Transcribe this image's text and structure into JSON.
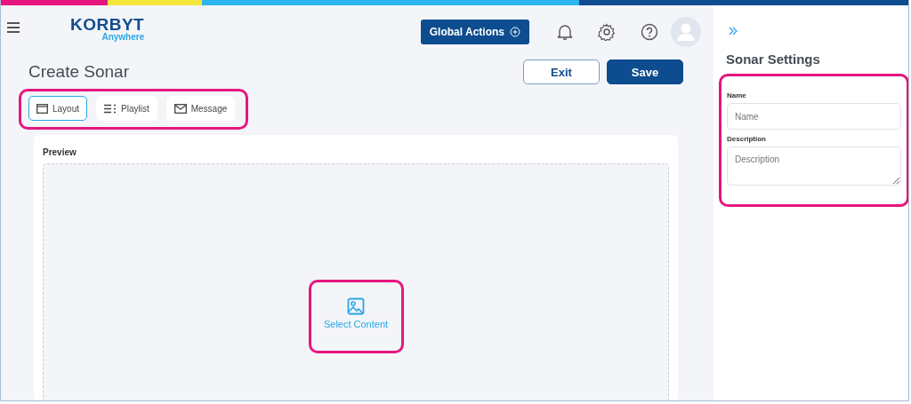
{
  "logo": {
    "wordmark": "KORBYT",
    "tagline": "Anywhere"
  },
  "header": {
    "global_actions": "Global Actions"
  },
  "page": {
    "title": "Create Sonar",
    "buttons": [
      {
        "label": "Exit",
        "kind": "secondary"
      },
      {
        "label": "Save",
        "kind": "primary"
      }
    ]
  },
  "tabs": [
    {
      "label": "Layout",
      "kind": "layout",
      "selected": true
    },
    {
      "label": "Playlist",
      "kind": "playlist",
      "selected": false
    },
    {
      "label": "Message",
      "kind": "message",
      "selected": false
    }
  ],
  "preview": {
    "label": "Preview",
    "action": "Select Content"
  },
  "settings": {
    "title": "Sonar Settings",
    "fields": [
      {
        "label": "Name",
        "placeholder": "Name",
        "kind": "input"
      },
      {
        "label": "Description",
        "placeholder": "Description",
        "kind": "textarea"
      }
    ]
  }
}
